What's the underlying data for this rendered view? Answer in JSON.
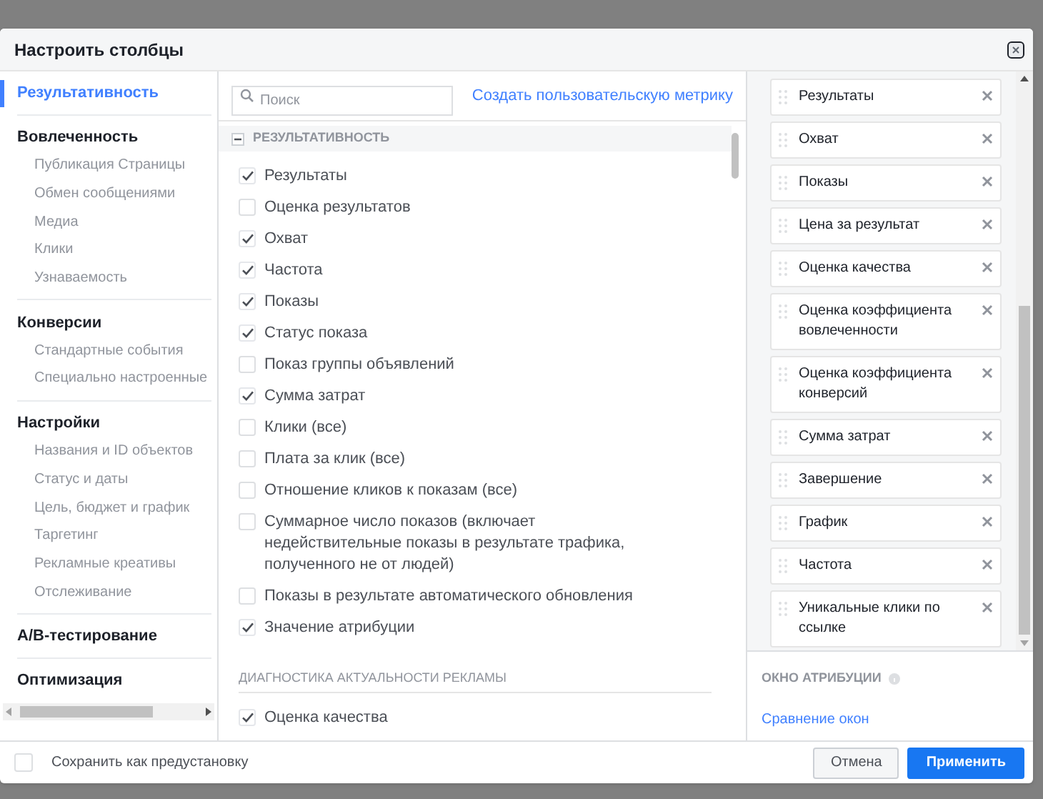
{
  "dialog": {
    "title": "Настроить столбцы"
  },
  "nav": [
    {
      "label": "Результативность",
      "selected": true
    },
    {
      "label": "Вовлеченность",
      "selected": false,
      "children": [
        {
          "label": "Публикация Страницы",
          "selected": false
        },
        {
          "label": "Обмен сообщениями",
          "selected": false
        },
        {
          "label": "Медиа",
          "selected": false
        },
        {
          "label": "Клики",
          "selected": false
        },
        {
          "label": "Узнаваемость",
          "selected": false
        }
      ]
    },
    {
      "label": "Конверсии",
      "selected": false,
      "children": [
        {
          "label": "Стандартные события",
          "selected": false
        },
        {
          "label": "Специально настроенные",
          "selected": false
        }
      ]
    },
    {
      "label": "Настройки",
      "selected": false,
      "children": [
        {
          "label": "Названия и ID объектов",
          "selected": false
        },
        {
          "label": "Статус и даты",
          "selected": false
        },
        {
          "label": "Цель, бюджет и график",
          "selected": false
        },
        {
          "label": "Таргетинг",
          "selected": false
        },
        {
          "label": "Рекламные креативы",
          "selected": false
        },
        {
          "label": "Отслеживание",
          "selected": false
        }
      ]
    },
    {
      "label": "A/B-тестирование",
      "selected": false
    },
    {
      "label": "Оптимизация",
      "selected": false
    }
  ],
  "search": {
    "placeholder": "Поиск"
  },
  "create_link": "Создать пользовательскую метрику",
  "sections": [
    {
      "title": "РЕЗУЛЬТАТИВНОСТЬ",
      "expanded": true,
      "items": [
        {
          "label": "Результаты",
          "checked": true
        },
        {
          "label": "Оценка результатов",
          "checked": false
        },
        {
          "label": "Охват",
          "checked": true
        },
        {
          "label": "Частота",
          "checked": true
        },
        {
          "label": "Показы",
          "checked": true
        },
        {
          "label": "Статус показа",
          "checked": true
        },
        {
          "label": "Показ группы объявлений",
          "checked": false
        },
        {
          "label": "Сумма затрат",
          "checked": true
        },
        {
          "label": "Клики (все)",
          "checked": false
        },
        {
          "label": "Плата за клик (все)",
          "checked": false
        },
        {
          "label": "Отношение кликов к показам (все)",
          "checked": false
        },
        {
          "label": "Суммарное число показов (включает недействительные показы в результате трафика, полученного не от людей)",
          "checked": false
        },
        {
          "label": "Показы в результате автоматического обновления",
          "checked": false
        },
        {
          "label": "Значение атрибуции",
          "checked": true
        }
      ]
    },
    {
      "title": "ДИАГНОСТИКА АКТУАЛЬНОСТИ РЕКЛАМЫ",
      "items": [
        {
          "label": "Оценка качества",
          "checked": true
        }
      ]
    }
  ],
  "selected_columns": [
    "Результаты",
    "Охват",
    "Показы",
    "Цена за результат",
    "Оценка качества",
    "Оценка коэффициента вовлеченности",
    "Оценка коэффициента конверсий",
    "Сумма затрат",
    "Завершение",
    "График",
    "Частота",
    "Уникальные клики по ссылке"
  ],
  "attribution": {
    "title": "ОКНО АТРИБУЦИИ",
    "link": "Сравнение окон"
  },
  "footer": {
    "save_preset": {
      "label": "Сохранить как предустановку",
      "checked": false
    },
    "buttons": [
      {
        "label": "Отмена",
        "kind": "secondary"
      },
      {
        "label": "Применить",
        "kind": "primary"
      }
    ]
  }
}
